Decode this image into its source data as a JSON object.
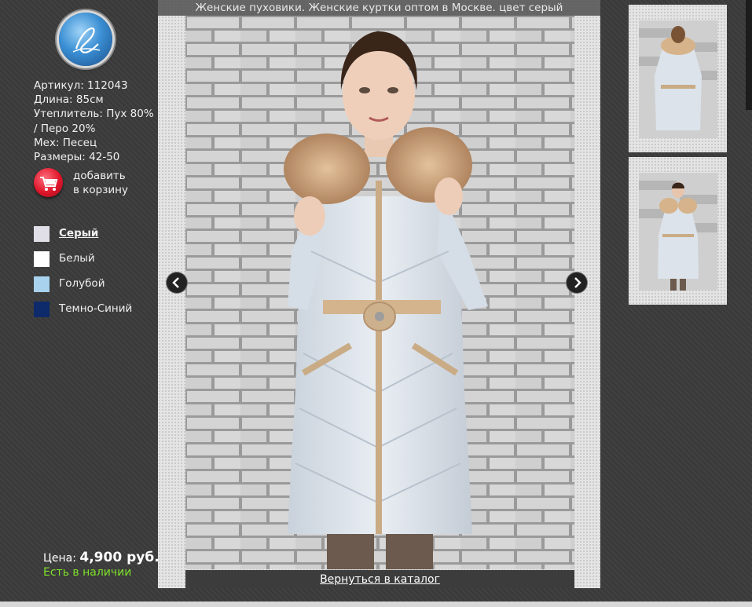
{
  "title": "Женские пуховики. Женские куртки оптом в Москве. цвет серый",
  "specs": [
    "Артикул: 112043",
    "Длина: 85см",
    "Утеплитель: Пух 80% / Перо 20%",
    "Мех: Песец",
    "Размеры: 42-50"
  ],
  "cart": {
    "label_line1": "добавить",
    "label_line2": "в корзину",
    "icon": "shopping-cart-icon"
  },
  "colors": [
    {
      "label": "Серый",
      "swatch": "#e0dfe8",
      "active": true
    },
    {
      "label": "Белый",
      "swatch": "#ffffff",
      "active": false
    },
    {
      "label": "Голубой",
      "swatch": "#a8d2ee",
      "active": false
    },
    {
      "label": "Темно-Синий",
      "swatch": "#0d2a6a",
      "active": false
    }
  ],
  "price": {
    "label": "Цена:",
    "value": "4,900 руб."
  },
  "stock": "Есть в наличии",
  "back_link": "Вернуться в каталог",
  "accent_colors": {
    "stock_green": "#7ee02a",
    "cart_red": "#e0162b"
  }
}
